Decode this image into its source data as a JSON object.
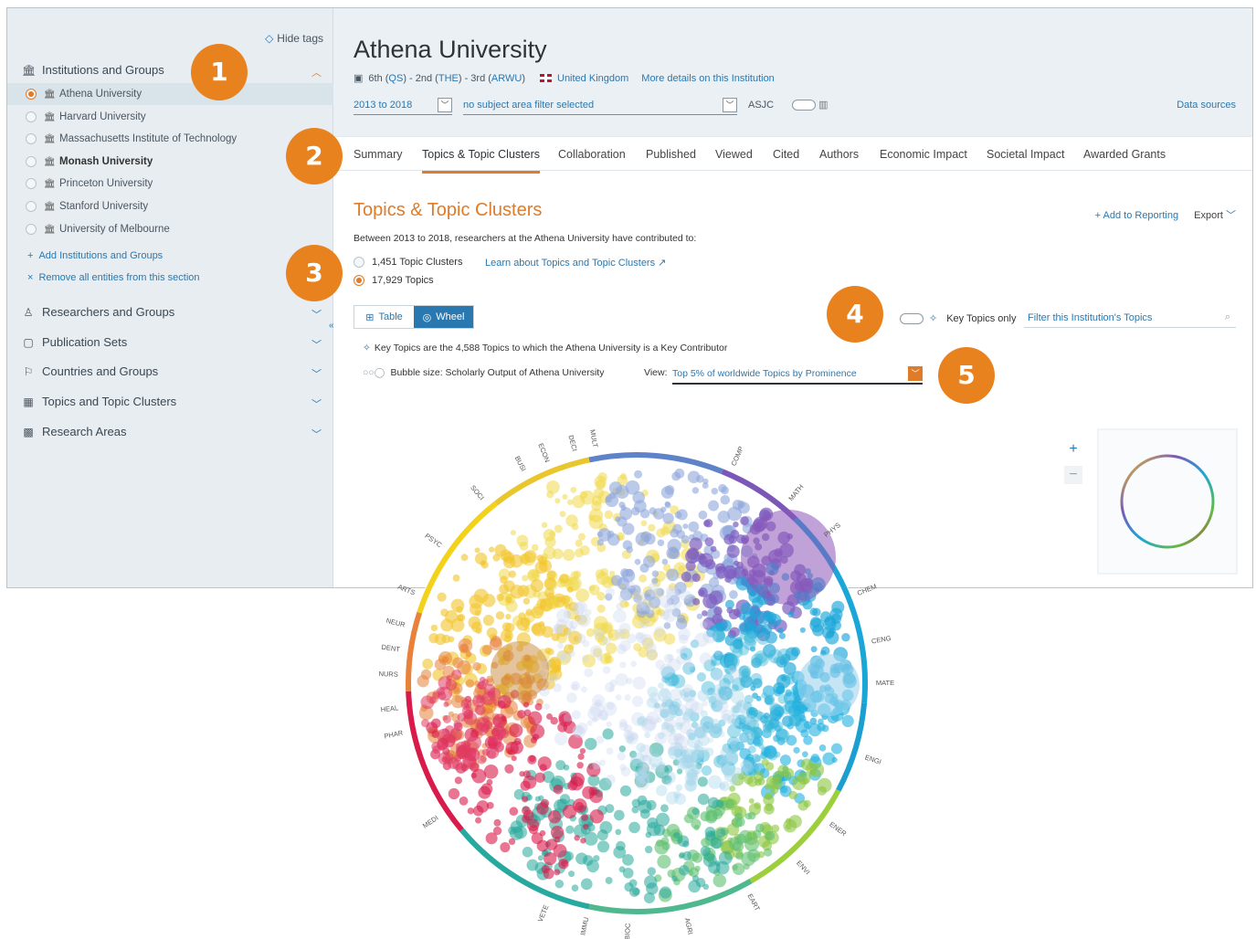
{
  "sidebar": {
    "hide_tags": "Hide tags",
    "sections": [
      {
        "label": "Institutions and Groups",
        "icon": "bank-icon"
      },
      {
        "label": "Researchers and Groups",
        "icon": "person-icon"
      },
      {
        "label": "Publication Sets",
        "icon": "document-icon"
      },
      {
        "label": "Countries and Groups",
        "icon": "flag-icon"
      },
      {
        "label": "Topics and Topic Clusters",
        "icon": "topics-icon"
      },
      {
        "label": "Research Areas",
        "icon": "grid-icon"
      }
    ],
    "institutions": [
      {
        "name": "Athena University",
        "selected": true
      },
      {
        "name": "Harvard University",
        "selected": false
      },
      {
        "name": "Massachusetts Institute of Technology",
        "selected": false
      },
      {
        "name": "Monash University",
        "selected": false
      },
      {
        "name": "Princeton University",
        "selected": false
      },
      {
        "name": "Stanford University",
        "selected": false
      },
      {
        "name": "University of Melbourne",
        "selected": false
      }
    ],
    "add_link": "Add Institutions and Groups",
    "remove_link": "Remove all entities from this section"
  },
  "header": {
    "title": "Athena University",
    "rank_qs": "6th (",
    "qs": "QS",
    "rank_the": ") - 2nd (",
    "the": "THE",
    "rank_arwu": ") - 3rd (",
    "arwu": "ARWU",
    "rank_end": ")",
    "country": "United Kingdom",
    "more": "More details on this Institution",
    "year_range": "2013 to 2018",
    "subject_filter": "no subject area filter selected",
    "asjc": "ASJC",
    "data_sources": "Data sources"
  },
  "tabs": [
    "Summary",
    "Topics & Topic Clusters",
    "Collaboration",
    "Published",
    "Viewed",
    "Cited",
    "Authors",
    "Economic Impact",
    "Societal Impact",
    "Awarded Grants"
  ],
  "section": {
    "title": "Topics & Topic Clusters",
    "add_reporting": "Add to Reporting",
    "export": "Export",
    "description": "Between 2013 to 2018, researchers at the Athena University have contributed to:",
    "option_clusters": "1,451 Topic Clusters",
    "option_topics": "17,929 Topics",
    "learn_link": "Learn about Topics and Topic Clusters",
    "view_table": "Table",
    "view_wheel": "Wheel",
    "key_only": "Key Topics only",
    "filter_placeholder": "Filter this Institution's Topics",
    "key_note": "Key Topics are the 4,588 Topics to which the Athena University is a Key Contributor",
    "bubble_size": "Bubble size:  Scholarly Output of Athena University",
    "view_label": "View:",
    "view_value": "Top 5% of worldwide Topics by Prominence"
  },
  "badges": [
    "1",
    "2",
    "3",
    "4",
    "5"
  ],
  "wheel_labels": [
    "COMP",
    "MATH",
    "PHYS",
    "CHEM",
    "CENG",
    "MATE",
    "ENGI",
    "ENER",
    "ENVI",
    "EART",
    "AGRI",
    "BIOC",
    "IMMU",
    "VETE",
    "MEDI",
    "PHAR",
    "HEAL",
    "NURS",
    "DENT",
    "NEUR",
    "ARTS",
    "PSYC",
    "SOCI",
    "BUSI",
    "ECON",
    "DECI",
    "MULT"
  ],
  "colors": {
    "accent": "#e07b28",
    "link": "#2a78b0",
    "badge": "#e8821f"
  }
}
